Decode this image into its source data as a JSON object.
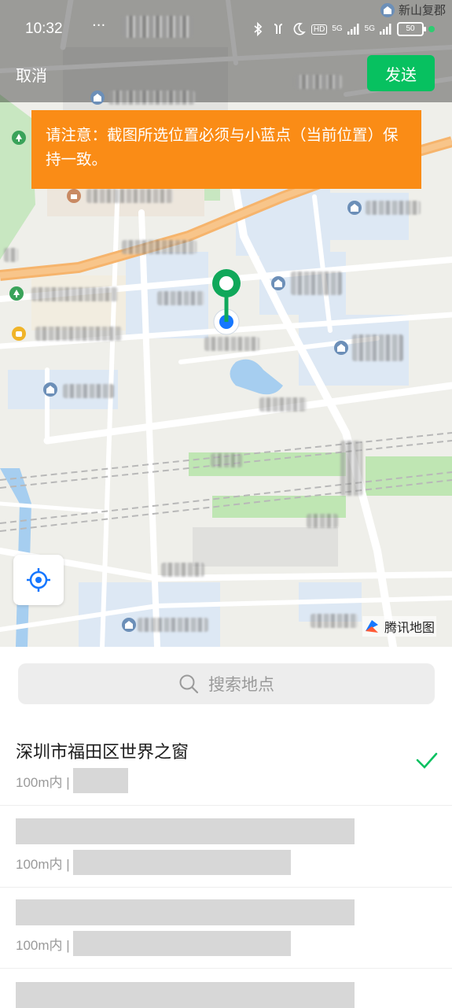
{
  "status_bar": {
    "time": "10:32",
    "dots": "···",
    "hd_label": "HD",
    "net_1": "5G",
    "net_2": "5G",
    "battery": "50",
    "place_label": "新山复郡"
  },
  "header": {
    "cancel_label": "取消",
    "send_label": "发送"
  },
  "warning": {
    "text": "请注意：截图所选位置必须与小蓝点（当前位置）保持一致。"
  },
  "map": {
    "provider": "腾讯地图"
  },
  "search": {
    "placeholder": "搜索地点"
  },
  "results": [
    {
      "title": "深圳市福田区世界之窗",
      "distance": "100m内 |",
      "selected": true
    },
    {
      "title": "",
      "distance": "100m内 |",
      "selected": false
    },
    {
      "title": "",
      "distance": "100m内 |",
      "selected": false
    }
  ],
  "colors": {
    "accent_green": "#07c160",
    "warning_orange": "#fa8c16",
    "location_blue": "#1677ff"
  }
}
